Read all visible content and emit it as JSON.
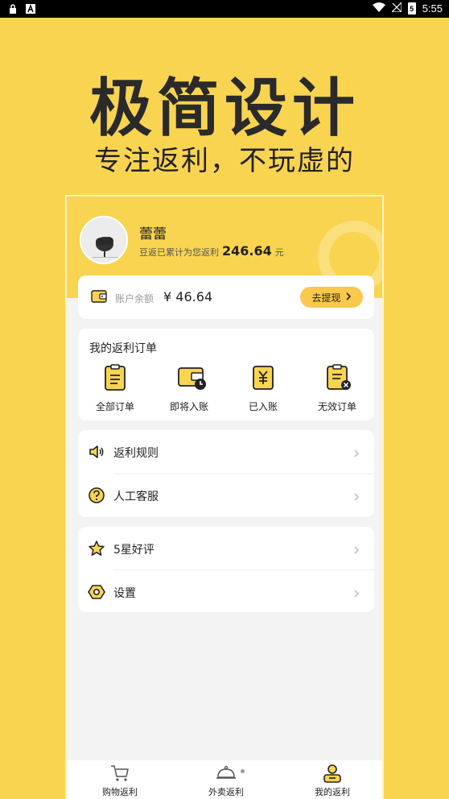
{
  "status_bar": {
    "time": "5:55",
    "battery": "5"
  },
  "promo": {
    "headline": "极简设计",
    "subline": "专注返利，不玩虚的"
  },
  "profile": {
    "username": "蕾蕾",
    "rebate_prefix": "豆返已累计为您返利",
    "rebate_amount": "246.64",
    "rebate_unit": "元"
  },
  "balance": {
    "label": "账户余额",
    "value": "¥ 46.64",
    "withdraw_label": "去提现"
  },
  "orders": {
    "title": "我的返利订单",
    "items": [
      {
        "label": "全部订单",
        "icon": "clipboard-list-icon"
      },
      {
        "label": "即将入账",
        "icon": "wallet-clock-icon"
      },
      {
        "label": "已入账",
        "icon": "yen-received-icon"
      },
      {
        "label": "无效订单",
        "icon": "clipboard-invalid-icon"
      }
    ]
  },
  "menu_group_1": [
    {
      "label": "返利规则",
      "icon": "speaker-icon"
    },
    {
      "label": "人工客服",
      "icon": "help-icon"
    }
  ],
  "menu_group_2": [
    {
      "label": "5星好评",
      "icon": "star-icon"
    },
    {
      "label": "设置",
      "icon": "settings-hexagon-icon"
    }
  ],
  "tabbar": [
    {
      "label": "购物返利",
      "icon": "cart-icon"
    },
    {
      "label": "外卖返利",
      "icon": "food-cloche-icon"
    },
    {
      "label": "我的返利",
      "icon": "person-icon",
      "active": true
    }
  ],
  "colors": {
    "brand_yellow": "#f9d450",
    "button_yellow": "#f9c84c",
    "text_dark": "#222222"
  }
}
